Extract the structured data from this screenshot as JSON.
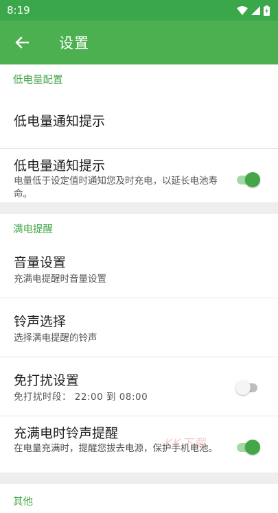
{
  "status_bar": {
    "time": "8:19"
  },
  "app_bar": {
    "title": "设置"
  },
  "sections": {
    "low_battery": {
      "header": "低电量配置",
      "item1_title": "低电量通知提示",
      "item2_title": "低电量通知提示",
      "item2_subtitle": "电量低于设定值时通知您及时充电，以延长电池寿命。",
      "item2_switch": true
    },
    "full_battery": {
      "header": "满电提醒",
      "volume_title": "音量设置",
      "volume_subtitle": "充满电提醒时音量设置",
      "ringtone_title": "铃声选择",
      "ringtone_subtitle": "选择满电提醒的铃声",
      "dnd_title": "免打扰设置",
      "dnd_label": "免打扰时段：",
      "dnd_start": "22:00",
      "dnd_to": "到",
      "dnd_end": "08:00",
      "dnd_switch": false,
      "full_ring_title": "充满电时铃声提醒",
      "full_ring_subtitle": "在电量充满时，提醒您拔去电源，保护手机电池。",
      "full_ring_switch": true
    },
    "other": {
      "header": "其他"
    }
  },
  "watermark": "KK下载",
  "colors": {
    "primary": "#4db050",
    "status_bar": "#3aa84a",
    "accent": "#43a648"
  }
}
